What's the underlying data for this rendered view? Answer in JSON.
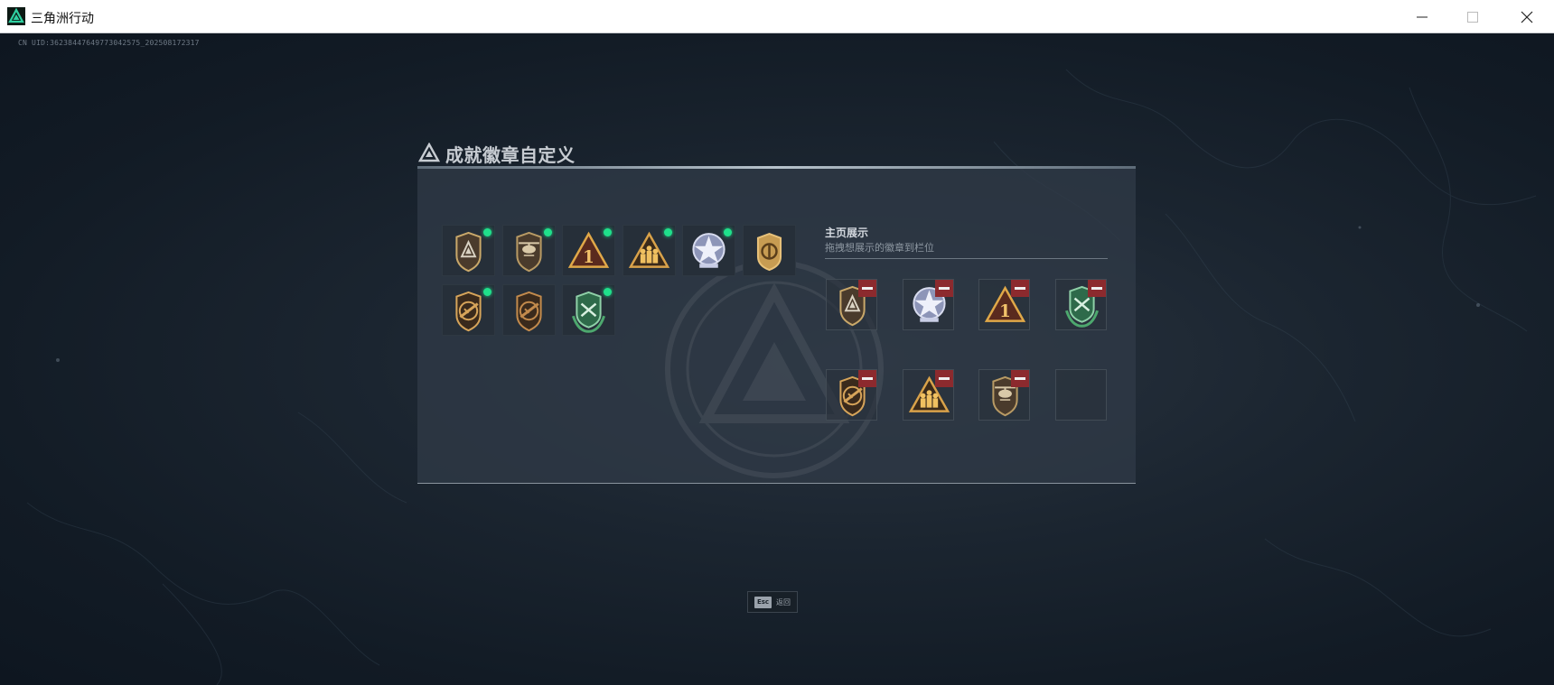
{
  "window": {
    "title": "三角洲行动"
  },
  "uid": "CN UID:3623844764977304257­5_202508172317",
  "dialog": {
    "title": "成就徽章自定义",
    "owned_badges": [
      {
        "icon": "delta-shield-badge-icon",
        "new": true
      },
      {
        "icon": "helicopter-shield-badge-icon",
        "new": true
      },
      {
        "icon": "number-one-triangle-badge-icon",
        "new": true
      },
      {
        "icon": "squad-triangle-badge-icon",
        "new": true
      },
      {
        "icon": "star-medal-badge-icon",
        "new": true
      },
      {
        "icon": "gold-emblem-badge-icon",
        "new": false
      },
      {
        "icon": "rifle-shield-badge-icon",
        "new": true
      },
      {
        "icon": "rifle-shield-bronze-badge-icon",
        "new": false
      },
      {
        "icon": "green-wreath-badge-icon",
        "new": true
      }
    ],
    "showcase": {
      "title": "主页展示",
      "subtitle": "拖拽想展示的徽章到栏位",
      "slots": [
        {
          "icon": "delta-shield-badge-icon"
        },
        {
          "icon": "star-medal-badge-icon"
        },
        {
          "icon": "number-one-triangle-badge-icon"
        },
        {
          "icon": "green-wreath-badge-icon"
        },
        {
          "icon": "rifle-shield-badge-icon"
        },
        {
          "icon": "squad-triangle-badge-icon"
        },
        {
          "icon": "helicopter-shield-badge-icon"
        },
        {
          "icon": ""
        }
      ]
    }
  },
  "footer": {
    "esc_key": "Esc",
    "esc_label": "返回"
  },
  "colors": {
    "new_indicator": "#1fe08b",
    "remove_button": "#8c2a2e",
    "accent_green": "#2fd0a0"
  }
}
